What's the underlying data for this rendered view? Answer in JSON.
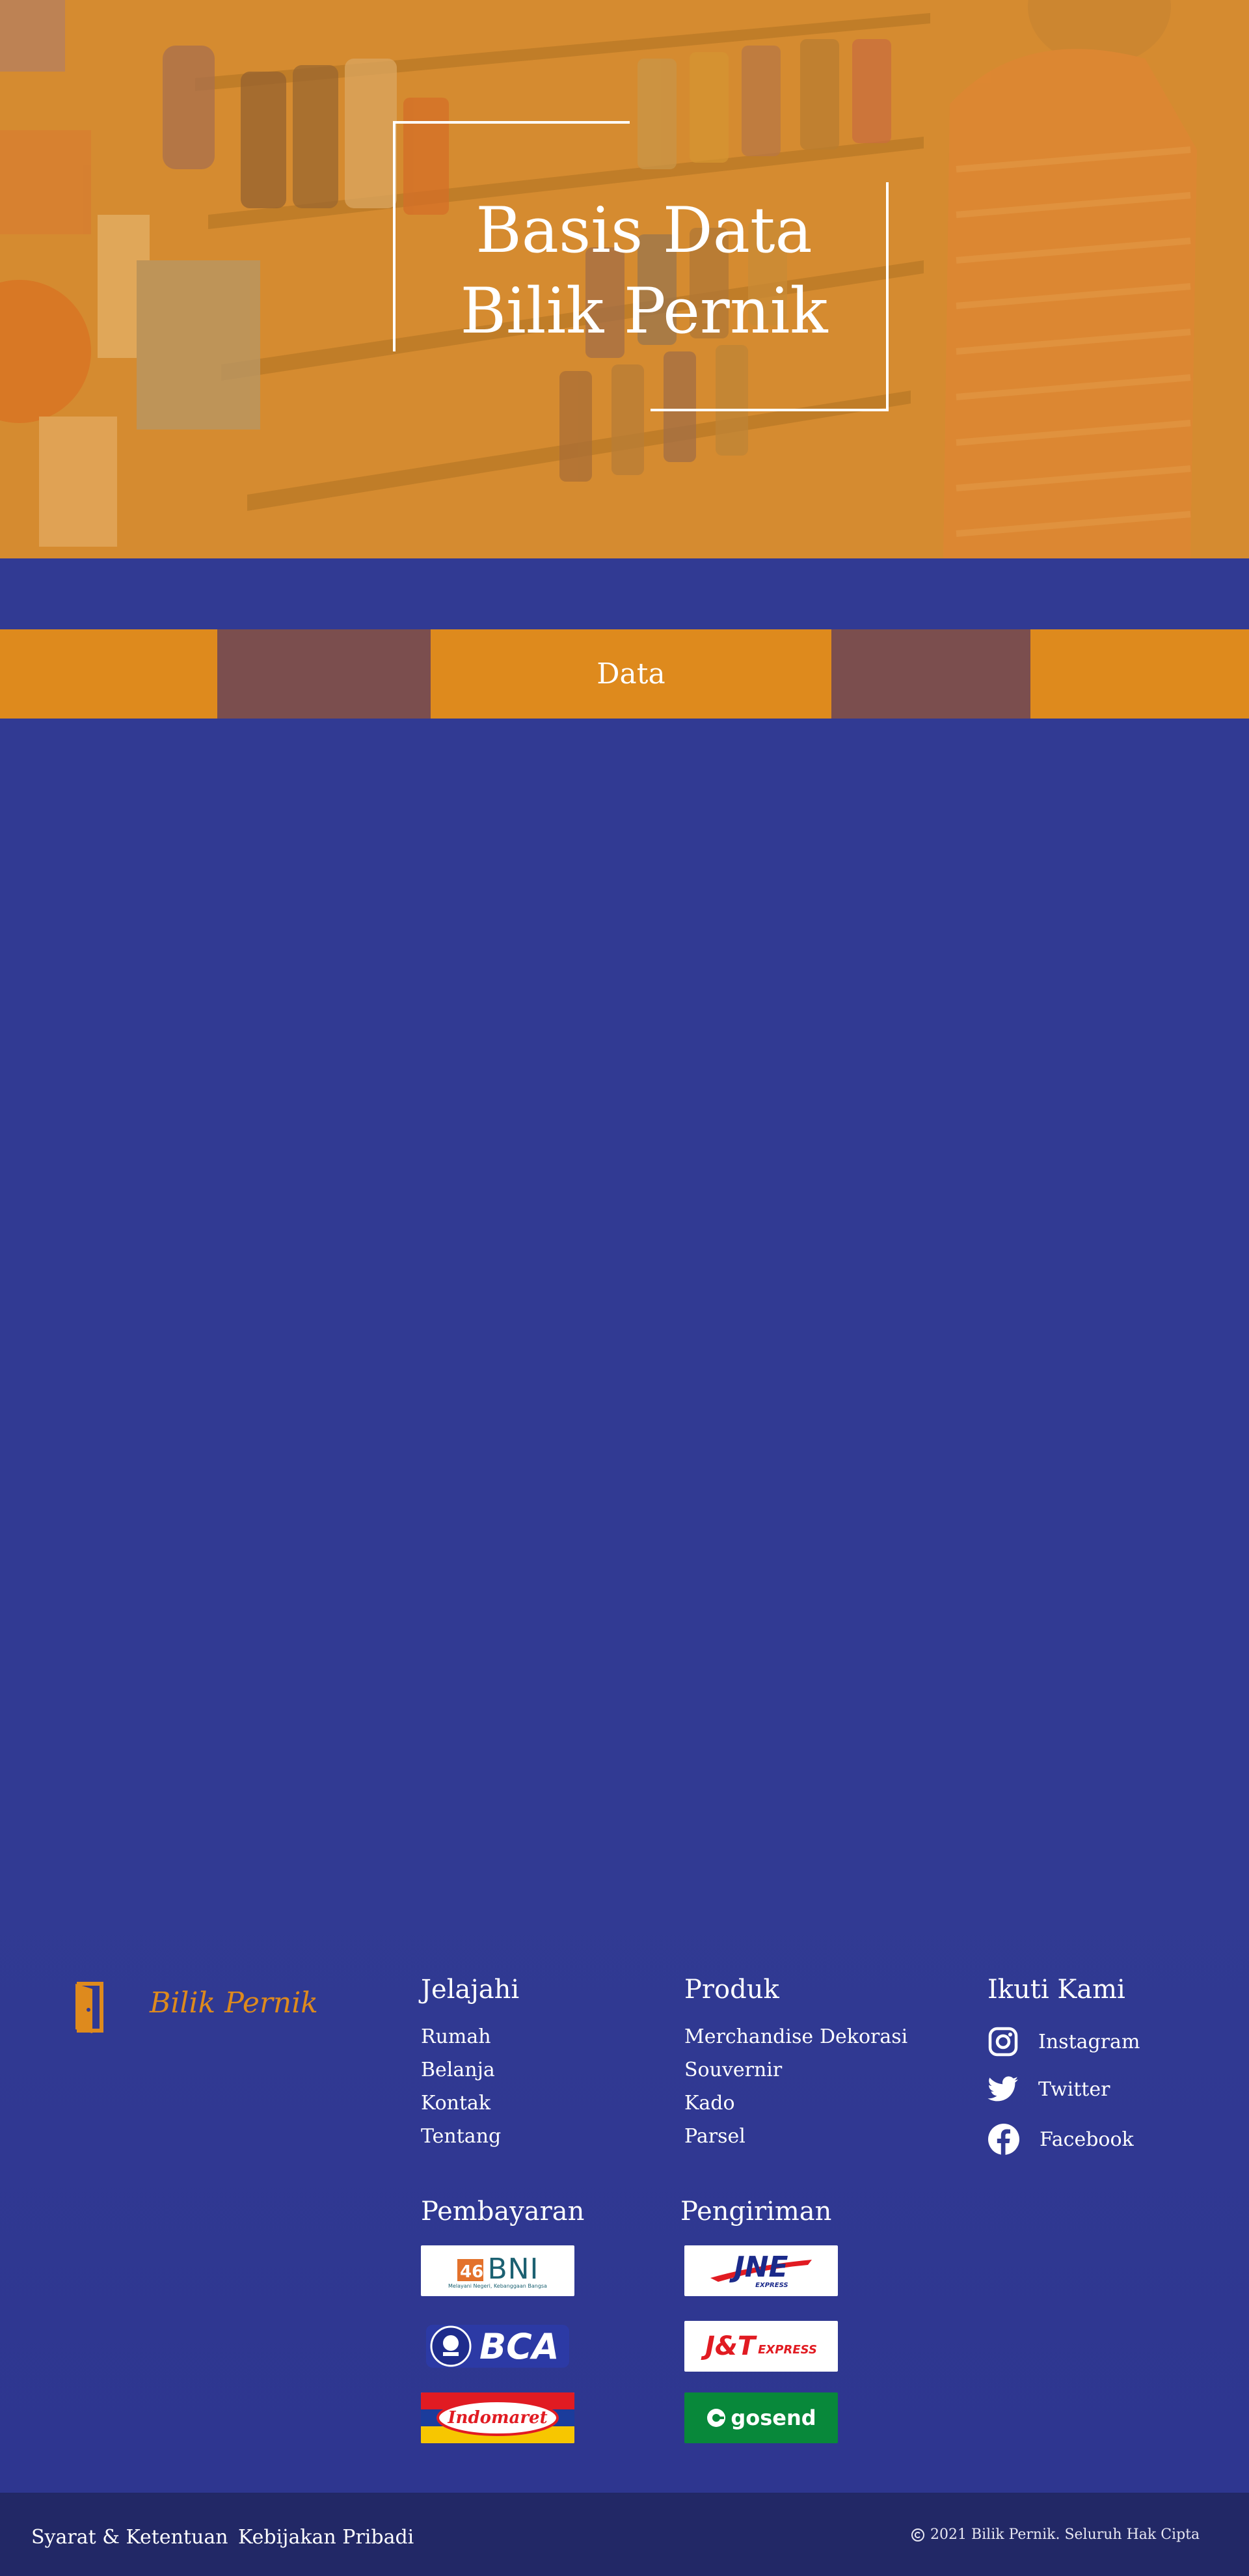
{
  "hero": {
    "title_line1": "Basis Data",
    "title_line2": "Bilik Pernik"
  },
  "tabs": {
    "active_label": "Data"
  },
  "footer": {
    "brand": "Bilik Pernik",
    "explore": {
      "title": "Jelajahi",
      "links": [
        "Rumah",
        "Belanja",
        "Kontak",
        "Tentang"
      ]
    },
    "products": {
      "title": "Produk",
      "links": [
        "Merchandise",
        "Dekorasi",
        "Souvernir",
        "Kado",
        "Parsel"
      ]
    },
    "follow": {
      "title": "Ikuti Kami",
      "links": [
        {
          "label": "Instagram",
          "icon": "instagram-icon"
        },
        {
          "label": "Twitter",
          "icon": "twitter-icon"
        },
        {
          "label": "Facebook",
          "icon": "facebook-icon"
        }
      ]
    },
    "payment": {
      "title": "Pembayaran",
      "bni_text": "BNI",
      "bni_tagline": "Melayani Negeri, Kebanggaan Bangsa",
      "bca_text": "BCA",
      "indomaret_text": "Indomaret"
    },
    "shipping": {
      "title": "Pengiriman",
      "jne_text": "JNE",
      "jne_sub": "EXPRESS",
      "jt_text": "J&T",
      "jt_sub": "EXPRESS",
      "gosend_text": "gosend"
    }
  },
  "bottom": {
    "terms": "Syarat & Ketentuan",
    "privacy": "Kebijakan Pribadi",
    "copyright": "2021 Bilik Pernik. Seluruh Hak Cipta"
  },
  "colors": {
    "page_bg": "#313a93",
    "accent_orange": "#de8a1d",
    "tab_side": "#7b4e4e",
    "bottom_bar": "#222866"
  }
}
